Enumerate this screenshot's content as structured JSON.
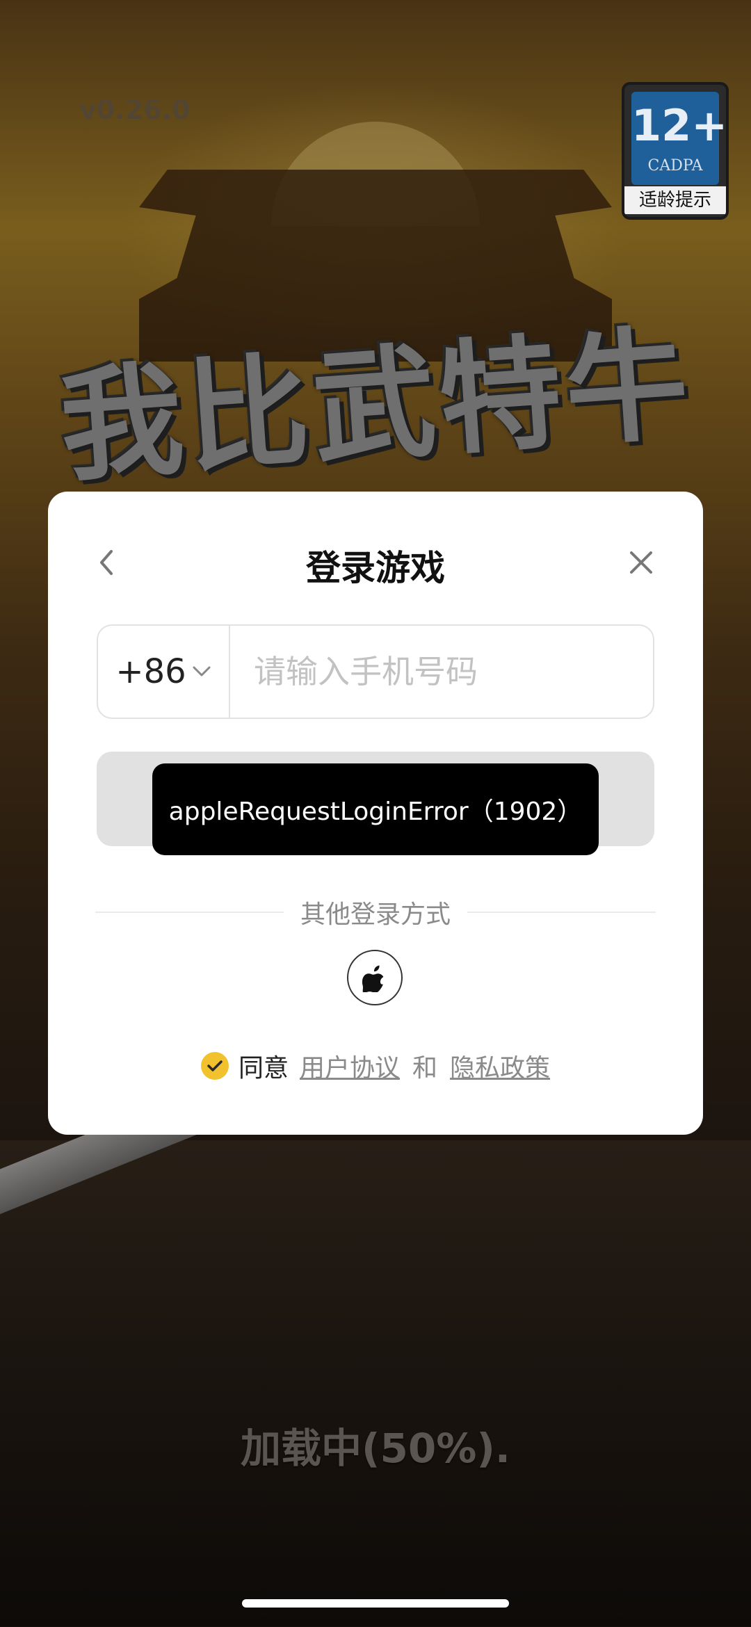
{
  "app": {
    "version": "v0.26.0",
    "game_title": "我比武特牛",
    "loading_text": "加载中(50%)."
  },
  "age_badge": {
    "rating": "12+",
    "org": "CADPA",
    "hint": "适龄提示"
  },
  "login_dialog": {
    "title": "登录游戏",
    "back_icon": "chevron-left-icon",
    "close_icon": "close-icon",
    "country_code": "+86",
    "phone_placeholder": "请输入手机号码",
    "phone_value": "",
    "login_button_label": "",
    "toast_text": "appleRequestLoginError（1902）",
    "other_methods_label": "其他登录方式",
    "apple_icon": "apple-icon",
    "agree": {
      "checked": true,
      "prefix": "同意",
      "user_agreement": "用户协议",
      "and": "和",
      "privacy_policy": "隐私政策"
    }
  },
  "colors": {
    "accent": "#f2c12e",
    "toast_bg": "#000000",
    "button_disabled": "#e1e1e1"
  }
}
